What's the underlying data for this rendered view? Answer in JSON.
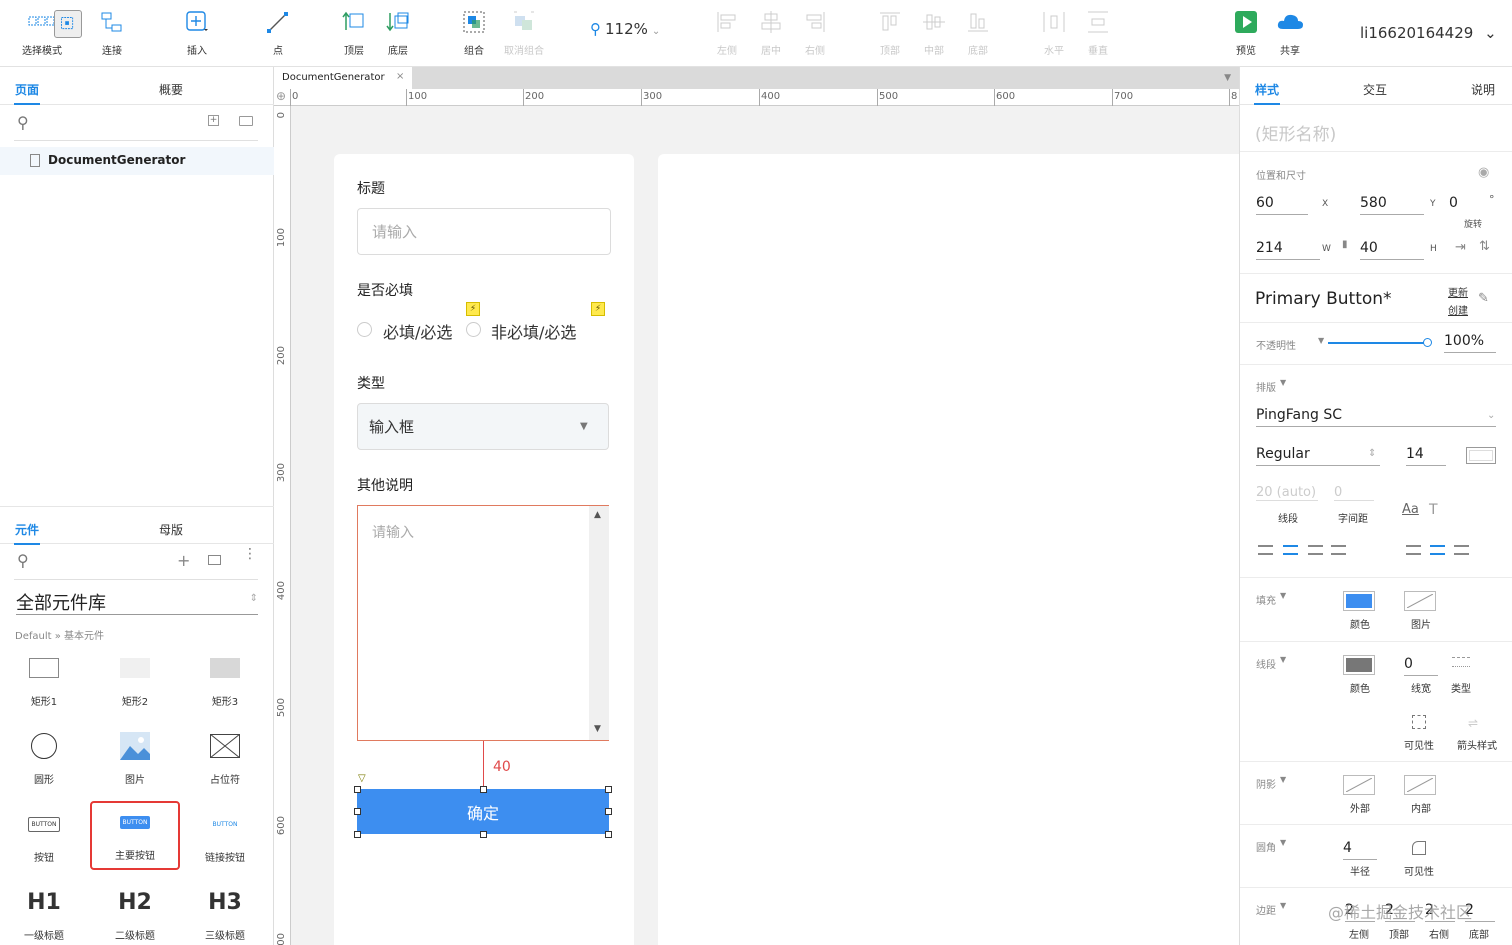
{
  "toolbar": {
    "select_mode": "选择模式",
    "connect": "连接",
    "insert": "插入",
    "point": "点",
    "top_layer": "顶层",
    "bottom_layer": "底层",
    "group": "组合",
    "ungroup": "取消组合",
    "zoom": "112%",
    "align_left": "左侧",
    "align_center": "居中",
    "align_right": "右侧",
    "align_top": "顶部",
    "align_middle": "中部",
    "align_bottom": "底部",
    "dist_h": "水平",
    "dist_v": "垂直",
    "preview": "预览",
    "share": "共享",
    "user": "li16620164429"
  },
  "left": {
    "tab_pages": "页面",
    "tab_outline": "概要",
    "page_name": "DocumentGenerator",
    "tab_widgets": "元件",
    "tab_masters": "母版",
    "library": "全部元件库",
    "library_sub": "Default » 基本元件",
    "widgets": [
      {
        "label": "矩形1"
      },
      {
        "label": "矩形2"
      },
      {
        "label": "矩形3"
      },
      {
        "label": "圆形"
      },
      {
        "label": "图片"
      },
      {
        "label": "占位符"
      },
      {
        "label": "按钮",
        "thumb": "BUTTON"
      },
      {
        "label": "主要按钮",
        "thumb": "BUTTON"
      },
      {
        "label": "链接按钮",
        "thumb": "BUTTON"
      },
      {
        "label": "一级标题",
        "thumb": "H1"
      },
      {
        "label": "二级标题",
        "thumb": "H2"
      },
      {
        "label": "三级标题",
        "thumb": "H3"
      }
    ]
  },
  "canvas": {
    "doc_tab": "DocumentGenerator",
    "ruler_h": [
      "0",
      "100",
      "200",
      "300",
      "400",
      "500",
      "600",
      "700",
      "8"
    ],
    "ruler_v": [
      "0",
      "100",
      "200",
      "300",
      "400",
      "500",
      "600",
      "00"
    ],
    "form": {
      "title_label": "标题",
      "title_placeholder": "请输入",
      "required_label": "是否必填",
      "radio_1": "必填/必选",
      "radio_2": "非必填/必选",
      "bolt": "⚡",
      "type_label": "类型",
      "type_value": "输入框",
      "notes_label": "其他说明",
      "notes_placeholder": "请输入",
      "spacing": "40",
      "confirm": "确定"
    }
  },
  "right": {
    "tab_style": "样式",
    "tab_interact": "交互",
    "tab_notes": "说明",
    "shape_name": "(矩形名称)",
    "pos_size": "位置和尺寸",
    "x": "60",
    "x_l": "X",
    "y": "580",
    "y_l": "Y",
    "rot": "0",
    "rot_unit": "°",
    "rot_l": "旋转",
    "w": "214",
    "w_l": "W",
    "h": "40",
    "h_l": "H",
    "style_name": "Primary Button*",
    "update": "更新",
    "create": "创建",
    "opacity_l": "不透明性",
    "opacity": "100%",
    "typo_l": "排版",
    "font": "PingFang SC",
    "weight": "Regular",
    "size": "14",
    "line_h": "20 (auto)",
    "line_h_l": "线段",
    "spacing": "0",
    "spacing_l": "字间距",
    "fill_l": "填充",
    "color_l": "颜色",
    "image_l": "图片",
    "stroke_l": "线段",
    "stroke_w": "0",
    "stroke_w_l": "线宽",
    "stroke_type_l": "类型",
    "visibility_l": "可见性",
    "arrow_l": "箭头样式",
    "shadow_l": "阴影",
    "outer_l": "外部",
    "inner_l": "内部",
    "corner_l": "圆角",
    "radius": "4",
    "radius_l": "半径",
    "padding_l": "边距",
    "pad_values": [
      "2",
      "2",
      "2",
      "2"
    ],
    "pad_labels": [
      "左侧",
      "顶部",
      "右侧",
      "底部"
    ],
    "watermark": "@稀土掘金技术社区",
    "fill_color": "#3d8ef0",
    "stroke_color": "#777777"
  }
}
